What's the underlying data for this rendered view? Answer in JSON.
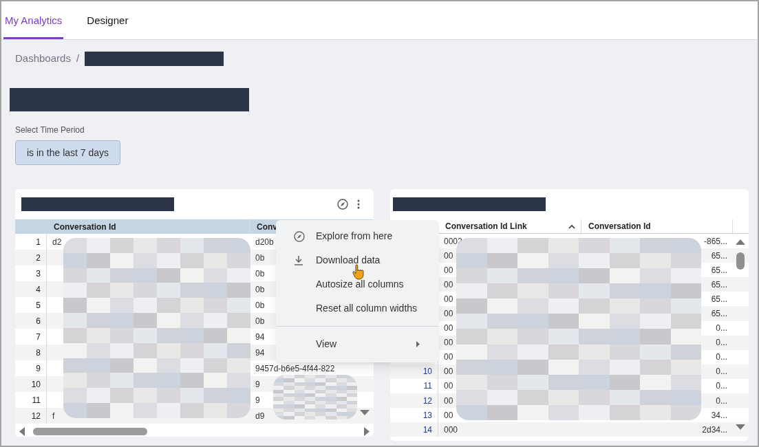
{
  "tabs": [
    {
      "label": "My Analytics",
      "selected": true
    },
    {
      "label": "Designer",
      "selected": false
    }
  ],
  "breadcrumb": {
    "link": "Dashboards",
    "separator": "/"
  },
  "filter": {
    "label": "Select Time Period",
    "value": "is in the last 7 days"
  },
  "tables": [
    {
      "columns": [
        {
          "label": "Conversation Id",
          "sorted": false
        },
        {
          "label": "Conv",
          "sorted": false
        }
      ],
      "rows": [
        {
          "number": "1",
          "cells": [
            "d2",
            "d20b"
          ]
        },
        {
          "number": "2",
          "cells": [
            "",
            "0b"
          ]
        },
        {
          "number": "3",
          "cells": [
            "",
            "0b"
          ]
        },
        {
          "number": "4",
          "cells": [
            "",
            "0b"
          ]
        },
        {
          "number": "5",
          "cells": [
            "",
            "0b"
          ]
        },
        {
          "number": "6",
          "cells": [
            "",
            "0b"
          ]
        },
        {
          "number": "7",
          "cells": [
            "",
            "94"
          ]
        },
        {
          "number": "8",
          "cells": [
            "",
            "94"
          ]
        },
        {
          "number": "9",
          "cells": [
            "",
            "9457d-b6e5-4f44-822"
          ]
        },
        {
          "number": "10",
          "cells": [
            "",
            "9"
          ]
        },
        {
          "number": "11",
          "cells": [
            "",
            "9"
          ]
        },
        {
          "number": "12",
          "cells": [
            "f",
            "d9"
          ]
        }
      ]
    },
    {
      "columns": [
        {
          "label": "Conversation Id Link",
          "sorted": true
        },
        {
          "label": "Conversation Id",
          "sorted": false
        }
      ],
      "rows": [
        {
          "number": "",
          "cells": [
            "0002",
            "-865..."
          ]
        },
        {
          "number": "",
          "cells": [
            "00",
            "65..."
          ]
        },
        {
          "number": "",
          "cells": [
            "00",
            "65..."
          ]
        },
        {
          "number": "",
          "cells": [
            "00",
            "65..."
          ]
        },
        {
          "number": "",
          "cells": [
            "00",
            "65..."
          ]
        },
        {
          "number": "",
          "cells": [
            "00",
            "65..."
          ]
        },
        {
          "number": "",
          "cells": [
            "00",
            "0..."
          ]
        },
        {
          "number": "",
          "cells": [
            "00",
            "0..."
          ]
        },
        {
          "number": "",
          "cells": [
            "00",
            "0..."
          ]
        },
        {
          "number": "10",
          "cells": [
            "00",
            "0..."
          ]
        },
        {
          "number": "11",
          "cells": [
            "00",
            "0..."
          ]
        },
        {
          "number": "12",
          "cells": [
            "00",
            "0..."
          ]
        },
        {
          "number": "13",
          "cells": [
            "00",
            "34..."
          ]
        },
        {
          "number": "14",
          "cells": [
            "000",
            "2d34..."
          ]
        }
      ]
    }
  ],
  "menu": {
    "items": [
      {
        "kind": "explore",
        "label": "Explore from here"
      },
      {
        "kind": "download",
        "label": "Download data"
      },
      {
        "kind": "plain",
        "label": "Autosize all columns"
      },
      {
        "kind": "plain",
        "label": "Reset all column widths"
      },
      {
        "kind": "submenu",
        "label": "View"
      }
    ]
  }
}
